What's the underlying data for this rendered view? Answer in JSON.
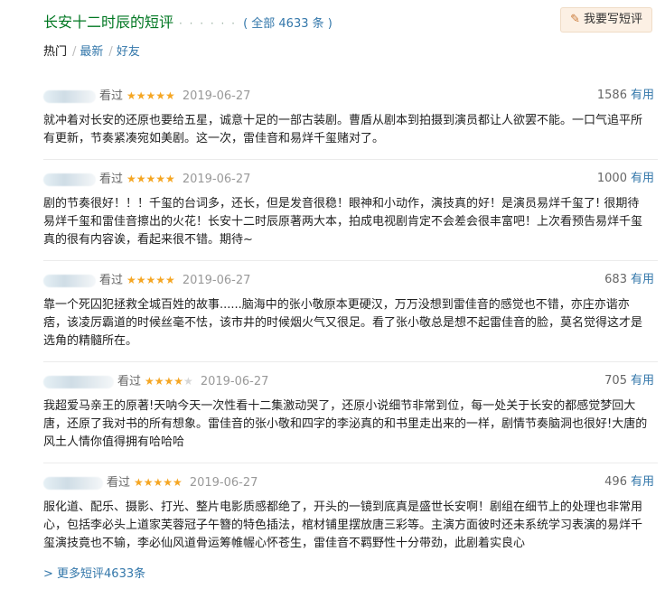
{
  "header": {
    "title": "长安十二时辰的短评",
    "dots": "· · · · · ·",
    "count": "( 全部 4633 条 )",
    "write_button": "我要写短评"
  },
  "tabs": [
    {
      "label": "热门"
    },
    {
      "label": "最新"
    },
    {
      "label": "好友"
    }
  ],
  "comments": [
    {
      "status": "看过",
      "rating": 5,
      "date": "2019-06-27",
      "votes": "1586",
      "useful": "有用",
      "text": "就冲着对长安的还原也要给五星，诚意十足的一部古装剧。曹盾从剧本到拍摄到演员都让人欲罢不能。一口气追平所有更新，节奏紧凑宛如美剧。这一次，雷佳音和易烊千玺赌对了。"
    },
    {
      "status": "看过",
      "rating": 5,
      "date": "2019-06-27",
      "votes": "1000",
      "useful": "有用",
      "text": "剧的节奏很好！！！千玺的台词多，还长，但是发音很稳！眼神和小动作，演技真的好！是演员易烊千玺了! 很期待易烊千玺和雷佳音擦出的火花！长安十二时辰原著两大本，拍成电视剧肯定不会差会很丰富吧！上次看预告易烊千玺真的很有内容诶，看起来很不错。期待~"
    },
    {
      "status": "看过",
      "rating": 5,
      "date": "2019-06-27",
      "votes": "683",
      "useful": "有用",
      "text": "靠一个死囚犯拯救全城百姓的故事......脑海中的张小敬原本更硬汉，万万没想到雷佳音的感觉也不错，亦庄亦谐亦痞，该凌厉霸道的时候丝毫不怯，该市井的时候烟火气又很足。看了张小敬总是想不起雷佳音的脸，莫名觉得这才是选角的精髓所在。"
    },
    {
      "status": "看过",
      "rating": 4,
      "date": "2019-06-27",
      "votes": "705",
      "useful": "有用",
      "text": "我超爱马亲王的原著!天呐今天一次性看十二集激动哭了，还原小说细节非常到位，每一处关于长安的都感觉梦回大唐，还原了我对书的所有想象。雷佳音的张小敬和四字的李泌真的和书里走出来的一样，剧情节奏脑洞也很好!大唐的风土人情你值得拥有哈哈哈"
    },
    {
      "status": "看过",
      "rating": 5,
      "date": "2019-06-27",
      "votes": "496",
      "useful": "有用",
      "text": "服化道、配乐、摄影、打光、整片电影质感都绝了，开头的一镜到底真是盛世长安啊！剧组在细节上的处理也非常用心，包括李必头上道家芙蓉冠子午簪的特色插法，棺材铺里摆放唐三彩等。主演方面彼时还未系统学习表演的易烊千玺演技竟也不输，李必仙风道骨运筹帷幄心怀苍生，雷佳音不羁野性十分带劲，此剧着实良心"
    }
  ],
  "more_link": "> 更多短评4633条"
}
